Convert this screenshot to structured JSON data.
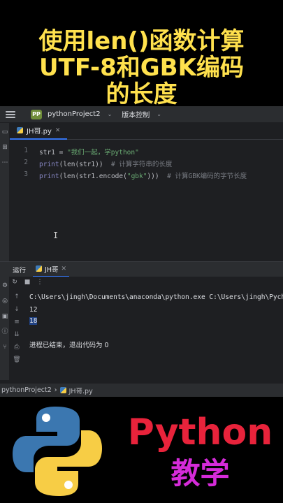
{
  "overlay": {
    "title_lines": [
      "使用len()函数计算",
      "UTF-8和GBK编码",
      "的长度"
    ],
    "title_color": "#ffe14d"
  },
  "ide": {
    "project_badge": "PP",
    "project_name": "pythonProject2",
    "vcs_label": "版本控制",
    "file_tab": "JH哥.py",
    "line_numbers": [
      "1",
      "2",
      "3"
    ],
    "code": {
      "line1": {
        "var": "str1",
        "op": " = ",
        "str": "\"我们一起，学python\""
      },
      "line2": {
        "pre": "p",
        "fn": "rint",
        "args": "(len(str1))",
        "comment": "  # 计算字符串的长度"
      },
      "line3": {
        "fn": "print",
        "args": "(len(str1.encode(",
        "str": "\"gbk\"",
        "close": ")))",
        "comment": "  # 计算GBK编码的字节长度"
      }
    },
    "run_label": "运行",
    "run_tab": "JH哥",
    "console_lines": [
      "C:\\Users\\jingh\\Documents\\anaconda\\python.exe C:\\Users\\jingh\\PycharmP",
      "12",
      "18",
      "",
      "进程已结束，退出代码为 0"
    ],
    "status_project": "pythonProject2",
    "status_file": "JH哥.py"
  },
  "banner": {
    "brand": "Python",
    "sub": "教学",
    "brand_color": "#e8233b",
    "sub_color": "#d52bd9"
  }
}
